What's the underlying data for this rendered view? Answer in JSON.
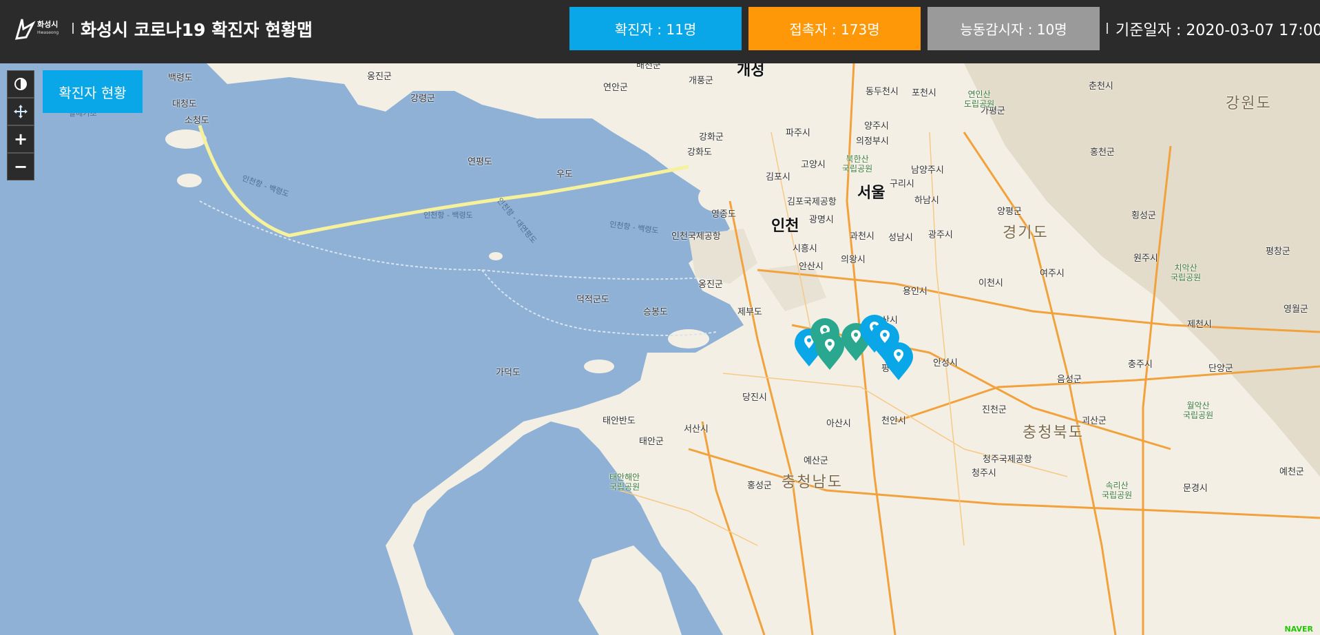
{
  "header": {
    "logo_text": "화성시",
    "logo_sub": "Hwaseong",
    "title": "화성시 코로나19 확진자 현황맵",
    "stats": {
      "confirmed": "확진자 : 11명",
      "contacts": "접촉자 : 173명",
      "monitoring": "능동감시자 : 10명"
    },
    "base_date": "기준일자 : 2020-03-07 17:00"
  },
  "map": {
    "status_button": "확진자 현황",
    "controls": {
      "zoom_in": "+",
      "zoom_out": "−"
    },
    "labels": {
      "seoul": "서울",
      "incheon": "인천",
      "gaeseong": "개성",
      "gyeonggi": "경기도",
      "gangwon": "강원도",
      "chungbuk": "충청북도",
      "chungnam": "충청남도",
      "baengnyeong": "백령도",
      "daecheong": "대청도",
      "socheong": "소청도",
      "ongjin_n": "옹진군",
      "gangnyeong": "강령군",
      "baecheon": "배천군",
      "yeonan": "연안군",
      "gaepung": "개풍군",
      "yeonpyeong": "연평도",
      "udo": "우도",
      "ganghwa_gun": "강화군",
      "ganghwa_do": "강화도",
      "gimpo": "김포시",
      "goyang": "고양시",
      "paju": "파주시",
      "yangju": "양주시",
      "dongducheon": "동두천시",
      "pocheon": "포천시",
      "gapyeong": "가평군",
      "chuncheon": "춘천시",
      "hongcheon": "홍천군",
      "uijeongbu": "의정부시",
      "namyangju": "남양주시",
      "guri": "구리시",
      "hanam": "하남시",
      "gwangmyeong": "광명시",
      "gwacheon": "과천시",
      "seongnam": "성남시",
      "gwangju": "광주시",
      "yangpyeong": "양평군",
      "hoengseong": "횡성군",
      "wonju": "원주시",
      "pyeongchang": "평창군",
      "siheung": "시흥시",
      "ansan": "안산시",
      "uiwang": "의왕시",
      "yongin": "용인시",
      "icheon": "이천시",
      "yeoju": "여주시",
      "yeongjong": "영종도",
      "incheon_airport": "인천국제공항",
      "gimpo_airport": "김포국제공항",
      "ongjin_s": "옹진군",
      "jebu": "제부도",
      "deokjeok": "덕적군도",
      "seungbong": "승봉도",
      "gadeok": "가덕도",
      "osan": "오산시",
      "pyeongtaek": "평택시",
      "anseong": "안성시",
      "jincheon": "진천군",
      "eumseong": "음성군",
      "chungju": "충주시",
      "jecheon": "제천시",
      "danyang": "단양군",
      "yeongwol": "영월군",
      "dangjin": "당진시",
      "taean_peninsula": "태안반도",
      "seosan": "서산시",
      "taean": "태안군",
      "asan": "아산시",
      "cheonan": "천안시",
      "yesan": "예산군",
      "hongseong": "홍성군",
      "goesan": "괴산군",
      "cheongju": "청주시",
      "cheongju_airport": "청주국제공항",
      "mungyeong": "문경시",
      "yecheon": "예천군",
      "ganghwa_sea": "갈매기초"
    },
    "parks": {
      "bukhansan": "북한산\n국립공원",
      "yeonin": "연인산\n도립공원",
      "chiak": "치악산\n국립공원",
      "worak": "월악산\n국립공원",
      "taean_coast": "태안해안\n국립공원",
      "songni": "속리산\n국립공원"
    },
    "routes": {
      "sea_route_1": "인천항 - 백령도",
      "sea_route_2": "인천항 - 백령도",
      "sea_route_3": "인천항 - 대연평도",
      "sea_route_4": "인천항 - 백령도"
    },
    "markers": [
      {
        "color": "#0aa7e8"
      },
      {
        "color": "#2aa88f"
      },
      {
        "color": "#2aa88f"
      },
      {
        "color": "#2aa88f"
      },
      {
        "color": "#0aa7e8"
      },
      {
        "color": "#0aa7e8"
      },
      {
        "color": "#0aa7e8"
      }
    ],
    "attribution": "NAVER"
  },
  "colors": {
    "confirmed": "#0aa7e8",
    "contacts": "#ff9808",
    "monitoring": "#9a9a9a",
    "header_bg": "#2b2b2b",
    "sea": "#8fb1d6",
    "land": "#f3efe4",
    "road": "#f2a23c",
    "marker_green": "#2aa88f"
  }
}
